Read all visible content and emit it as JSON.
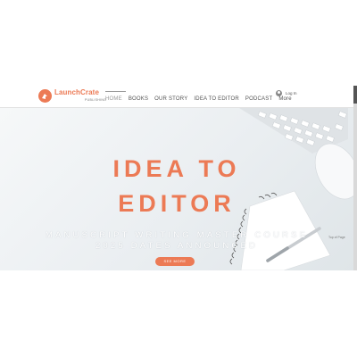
{
  "brand": {
    "name": "LaunchCrate",
    "tagline": "PUBLISHING",
    "color": "#ec7a55"
  },
  "nav": {
    "items": [
      {
        "label": "HOME",
        "active": true
      },
      {
        "label": "BOOKS"
      },
      {
        "label": "OUR STORY"
      },
      {
        "label": "IDEA TO EDITOR"
      },
      {
        "label": "PODCAST"
      },
      {
        "label": "More"
      }
    ],
    "login_label": "Log In"
  },
  "hero": {
    "headline_line1": "IDEA TO",
    "headline_line2": "EDITOR",
    "subtitle_line1": "MANUSCRIPT WRITING MASTER COURSE",
    "subtitle_line2": "2025 DATES ANNOUNCED",
    "cta_label": "SEE MORE",
    "top_of_page": "Top of Page"
  },
  "icons": [
    "logo-icon",
    "user-avatar-icon"
  ],
  "colors": {
    "accent": "#ec7a55",
    "hero_bg": "#eef1f3"
  }
}
